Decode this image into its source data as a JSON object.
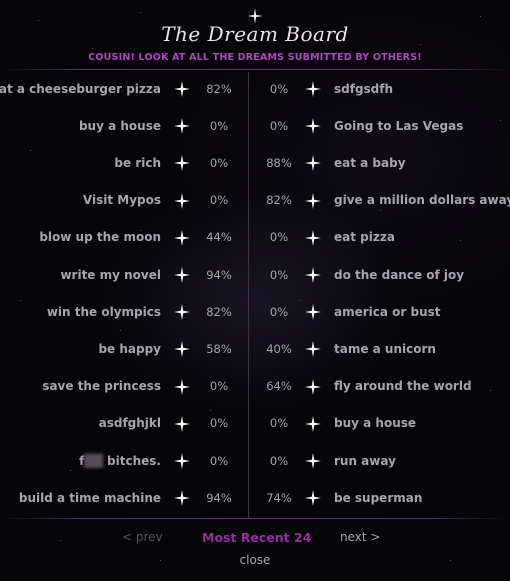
{
  "header": {
    "title": "The Dream Board",
    "tagline": "COUSIN! LOOK AT ALL THE DREAMS SUBMITTED BY OTHERS!"
  },
  "dreams_left": [
    {
      "name": "eat a cheeseburger pizza",
      "pct": "82%"
    },
    {
      "name": "buy a house",
      "pct": "0%"
    },
    {
      "name": "be rich",
      "pct": "0%"
    },
    {
      "name": "Visit Mypos",
      "pct": "0%"
    },
    {
      "name": "blow up the moon",
      "pct": "44%"
    },
    {
      "name": "write my novel",
      "pct": "94%"
    },
    {
      "name": "win the olympics",
      "pct": "82%"
    },
    {
      "name": "be happy",
      "pct": "58%"
    },
    {
      "name": "save the princess",
      "pct": "0%"
    },
    {
      "name": "asdfghjkl",
      "pct": "0%"
    },
    {
      "name_prefix": "f",
      "name_suffix": " bitches.",
      "pct": "0%"
    },
    {
      "name": "build a time machine",
      "pct": "94%"
    }
  ],
  "dreams_right": [
    {
      "name": "sdfgsdfh",
      "pct": "0%"
    },
    {
      "name": "Going to Las Vegas",
      "pct": "0%"
    },
    {
      "name": "eat a baby",
      "pct": "88%"
    },
    {
      "name": "give a million dollars away",
      "pct": "82%"
    },
    {
      "name": "eat pizza",
      "pct": "0%"
    },
    {
      "name": "do the dance of joy",
      "pct": "0%"
    },
    {
      "name": "america or bust",
      "pct": "0%"
    },
    {
      "name": "tame a unicorn",
      "pct": "40%"
    },
    {
      "name": "fly around the world",
      "pct": "64%"
    },
    {
      "name": "buy a house",
      "pct": "0%"
    },
    {
      "name": "run away",
      "pct": "0%"
    },
    {
      "name": "be superman",
      "pct": "74%"
    }
  ],
  "footer": {
    "prev_label": "< prev",
    "current_label": "Most Recent 24",
    "next_label": "next >",
    "close_label": "close"
  },
  "colors": {
    "accent": "#b046c0",
    "text": "#a7a4ad",
    "background": "#060508"
  },
  "icons": {
    "rate": "sparkle-star-icon",
    "logo": "sparkle-star-icon"
  }
}
